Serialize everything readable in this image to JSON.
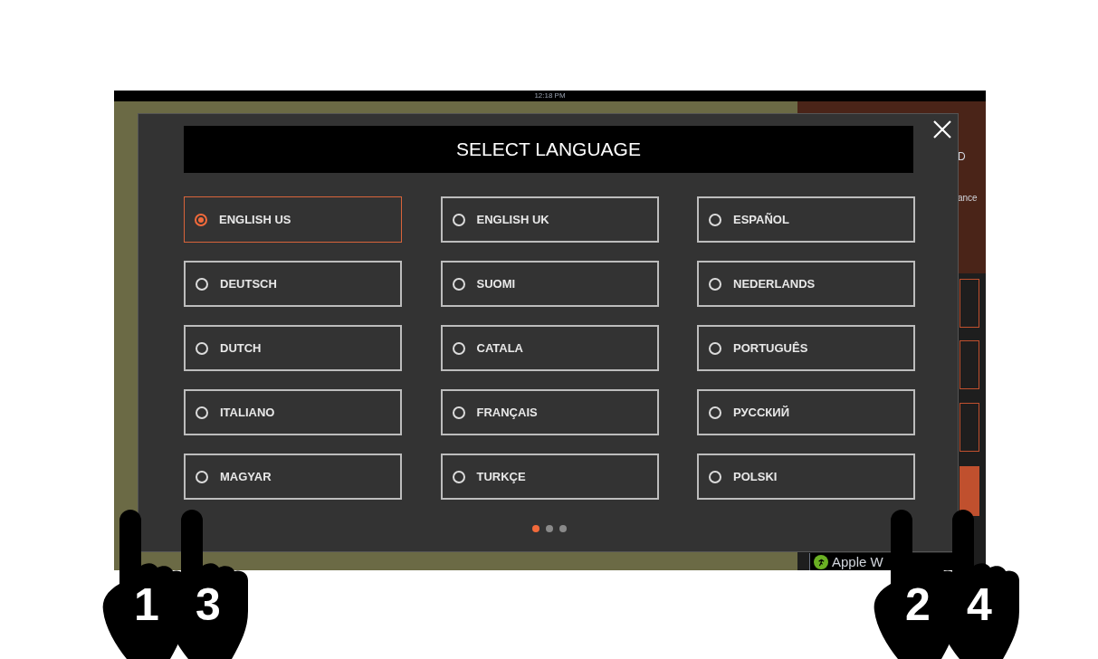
{
  "status_bar": {
    "time": "12:18 PM"
  },
  "background": {
    "fragments": [
      "D",
      "ance"
    ],
    "badge": "Apple W"
  },
  "dialog": {
    "title": "SELECT LANGUAGE",
    "options": [
      {
        "label": "ENGLISH US",
        "selected": true
      },
      {
        "label": "ENGLISH UK",
        "selected": false
      },
      {
        "label": "ESPAÑOL",
        "selected": false
      },
      {
        "label": "DEUTSCH",
        "selected": false
      },
      {
        "label": "SUOMI",
        "selected": false
      },
      {
        "label": "NEDERLANDS",
        "selected": false
      },
      {
        "label": "DUTCH",
        "selected": false
      },
      {
        "label": "CATALA",
        "selected": false
      },
      {
        "label": "PORTUGUÊS",
        "selected": false
      },
      {
        "label": "ITALIANO",
        "selected": false
      },
      {
        "label": "FRANÇAIS",
        "selected": false
      },
      {
        "label": "РУССКИЙ",
        "selected": false
      },
      {
        "label": "MAGYAR",
        "selected": false
      },
      {
        "label": "TURKÇE",
        "selected": false
      },
      {
        "label": "POLSKI",
        "selected": false
      }
    ],
    "pages": [
      {
        "selected": true
      },
      {
        "selected": false
      },
      {
        "selected": false
      }
    ]
  },
  "hands": [
    {
      "label": "1"
    },
    {
      "label": "3"
    },
    {
      "label": "2"
    },
    {
      "label": "4"
    }
  ]
}
